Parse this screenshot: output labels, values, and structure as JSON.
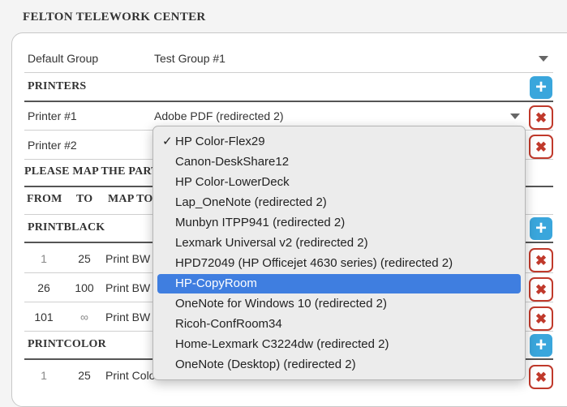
{
  "center_title": "FELTON TELEWORK CENTER",
  "default_group": {
    "label": "Default Group",
    "value": "Test Group #1"
  },
  "printers": {
    "heading": "PRINTERS",
    "items": [
      {
        "label": "Printer #1",
        "value": "Adobe PDF (redirected 2)"
      },
      {
        "label": "Printer #2",
        "value": ""
      }
    ]
  },
  "map_heading": "PLEASE MAP THE PART",
  "columns": {
    "from": "FROM",
    "to": "TO",
    "map_to": "MAP TO"
  },
  "printblack": {
    "heading": "PRINTBLACK",
    "rows": [
      {
        "from": "1",
        "to": "25",
        "map": "Print BW"
      },
      {
        "from": "26",
        "to": "100",
        "map": "Print BW"
      },
      {
        "from": "101",
        "to": "∞",
        "map": "Print BW"
      }
    ]
  },
  "printcolor": {
    "heading": "PRINTCOLOR",
    "rows": [
      {
        "from": "1",
        "to": "25",
        "map": "Print Colo"
      }
    ]
  },
  "dropdown": {
    "checked_index": 0,
    "highlighted_index": 7,
    "options": [
      "HP Color-Flex29",
      "Canon-DeskShare12",
      "HP Color-LowerDeck",
      "Lap_OneNote (redirected 2)",
      "Munbyn ITPP941 (redirected 2)",
      "Lexmark Universal v2 (redirected 2)",
      "HPD72049 (HP Officejet 4630 series) (redirected 2)",
      "HP-CopyRoom",
      "OneNote for Windows 10 (redirected 2)",
      "Ricoh-ConfRoom34",
      "Home-Lexmark C3224dw (redirected 2)",
      "OneNote (Desktop) (redirected 2)"
    ]
  },
  "icons": {
    "add": "+",
    "delete": "✖",
    "check": "✓"
  },
  "colors": {
    "add_button": "#3aa6dc",
    "delete_button": "#c0392b",
    "highlight": "#3f7ee0"
  }
}
